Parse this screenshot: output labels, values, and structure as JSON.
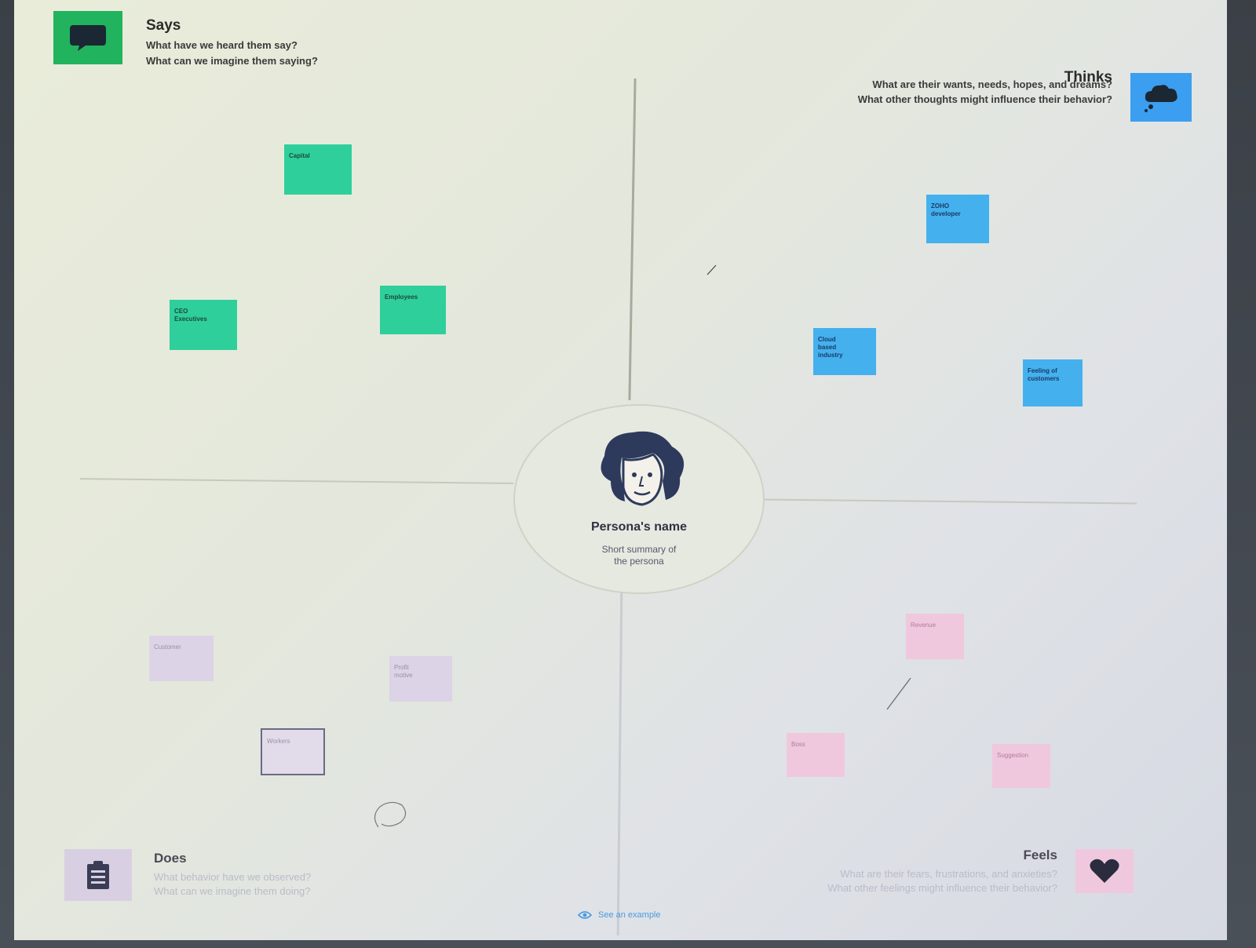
{
  "quadrants": {
    "says": {
      "title": "Says",
      "line1": "What have we heard them say?",
      "line2": "What can we imagine them saying?",
      "color": "#22b35e"
    },
    "thinks": {
      "title": "Thinks",
      "line1": "What are their wants, needs, hopes, and dreams?",
      "line2": "What other thoughts might influence their behavior?",
      "color": "#3b9ef0"
    },
    "does": {
      "title": "Does",
      "line1": "What behavior have we observed?",
      "line2": "What can we imagine them doing?",
      "color": "#d8d0e2"
    },
    "feels": {
      "title": "Feels",
      "line1": "What are their fears, frustrations, and anxieties?",
      "line2": "What other feelings might influence their behavior?",
      "color": "#f0c8de"
    }
  },
  "persona": {
    "name": "Persona's name",
    "summary_line1": "Short summary of",
    "summary_line2": "the persona"
  },
  "notes": {
    "capital": "Capital",
    "ceo": "CEO",
    "ceo2": "Executives",
    "employees": "Employees",
    "zoho": "ZOHO",
    "zoho2": "developer",
    "cloud": "Cloud",
    "cloud2": "based",
    "cloud3": "industry",
    "feeling": "Feeling of",
    "feeling2": "customers",
    "customer": "Customer",
    "profit": "Profit",
    "profit2": "motive",
    "workers": "Workers",
    "revenue": "Revenue",
    "boss": "Boss",
    "suggestion": "Suggestion"
  },
  "footer": {
    "see_example": "See an example"
  }
}
